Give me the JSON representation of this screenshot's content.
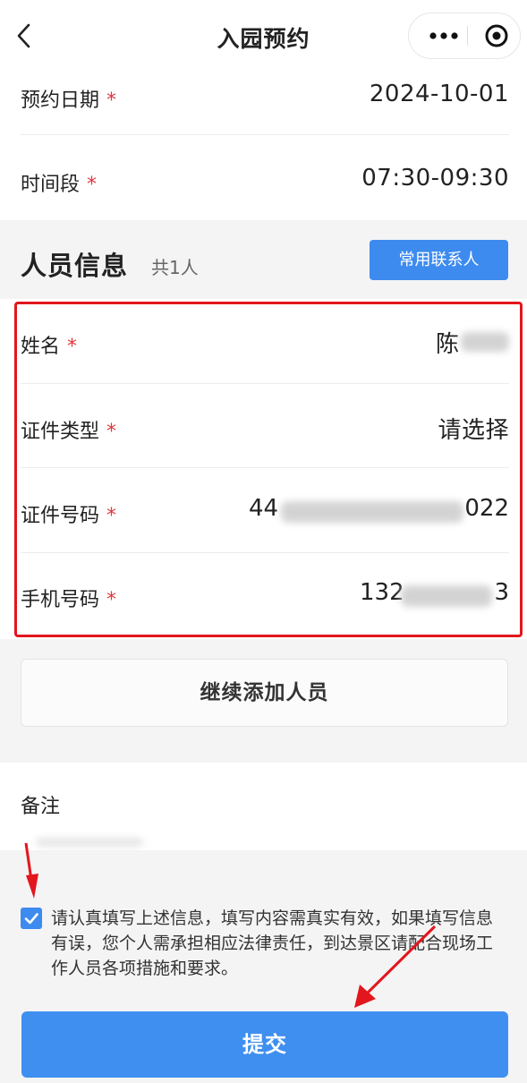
{
  "nav": {
    "title": "入园预约",
    "back_icon": "chevron-left-icon",
    "more_icon": "more-dots-icon",
    "close_icon": "target-close-icon"
  },
  "booking": {
    "date_label": "预约日期",
    "date_value": "2024-10-01",
    "time_label": "时间段",
    "time_value": "07:30-09:30",
    "required_mark": "*"
  },
  "people": {
    "title": "人员信息",
    "count": "共1人",
    "contacts_button": "常用联系人",
    "fields": [
      {
        "label": "姓名",
        "value": "陈"
      },
      {
        "label": "证件类型",
        "value": "请选择"
      },
      {
        "label": "证件号码",
        "value_prefix": "44",
        "value_suffix": "022"
      },
      {
        "label": "手机号码",
        "value_prefix": "132",
        "value_suffix": "3"
      }
    ]
  },
  "add_person_button": "继续添加人员",
  "remark": {
    "label": "备注"
  },
  "agreement": {
    "checked": true,
    "text": "请认真填写上述信息，填写内容需真实有效，如果填写信息有误，您个人需承担相应法律责任，到达景区请配合现场工作人员各项措施和要求。"
  },
  "submit_button": "提交",
  "colors": {
    "primary": "#3d8bef",
    "required": "#e0383e",
    "highlight_box": "#e3161d",
    "annotation_arrow": "#e3161d"
  }
}
